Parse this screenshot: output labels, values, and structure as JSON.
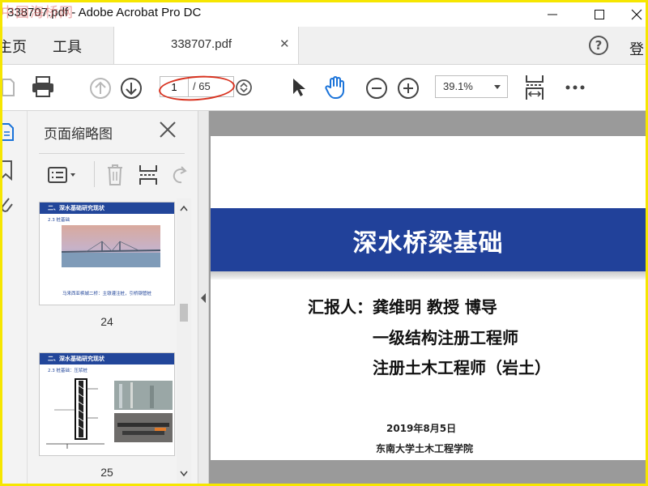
{
  "window": {
    "title": "338707.pdf - Adobe Acrobat Pro DC",
    "watermark": "中国海桥网"
  },
  "tabs": {
    "home": "主页",
    "tools": "工具",
    "document": "338707.pdf",
    "login": "登"
  },
  "toolbar": {
    "current_page": "1",
    "total_pages": "/ 65",
    "zoom": "39.1%"
  },
  "thumbnails_panel": {
    "title": "页面缩略图",
    "items": [
      {
        "page": "24",
        "header": "二、深水基础研究现状",
        "subheading": "2.3 桩基础",
        "caption": "马来西亚槟城二桥：主墩灌注桩，引桥钢管桩"
      },
      {
        "page": "25",
        "header": "二、深水基础研究现状",
        "subheading": "2.3 桩基础：压浆桩"
      }
    ]
  },
  "slide": {
    "title": "深水桥梁基础",
    "reporter_line1": "汇报人：龚维明 教授 博导",
    "reporter_line2": "一级结构注册工程师",
    "reporter_line3": "注册土木工程师（岩土）",
    "date": "2019年8月5日",
    "organization": "东南大学土木工程学院"
  },
  "colors": {
    "slide_banner": "#21419a",
    "annotation": "#d8321f",
    "outer_border": "#f6e600"
  }
}
